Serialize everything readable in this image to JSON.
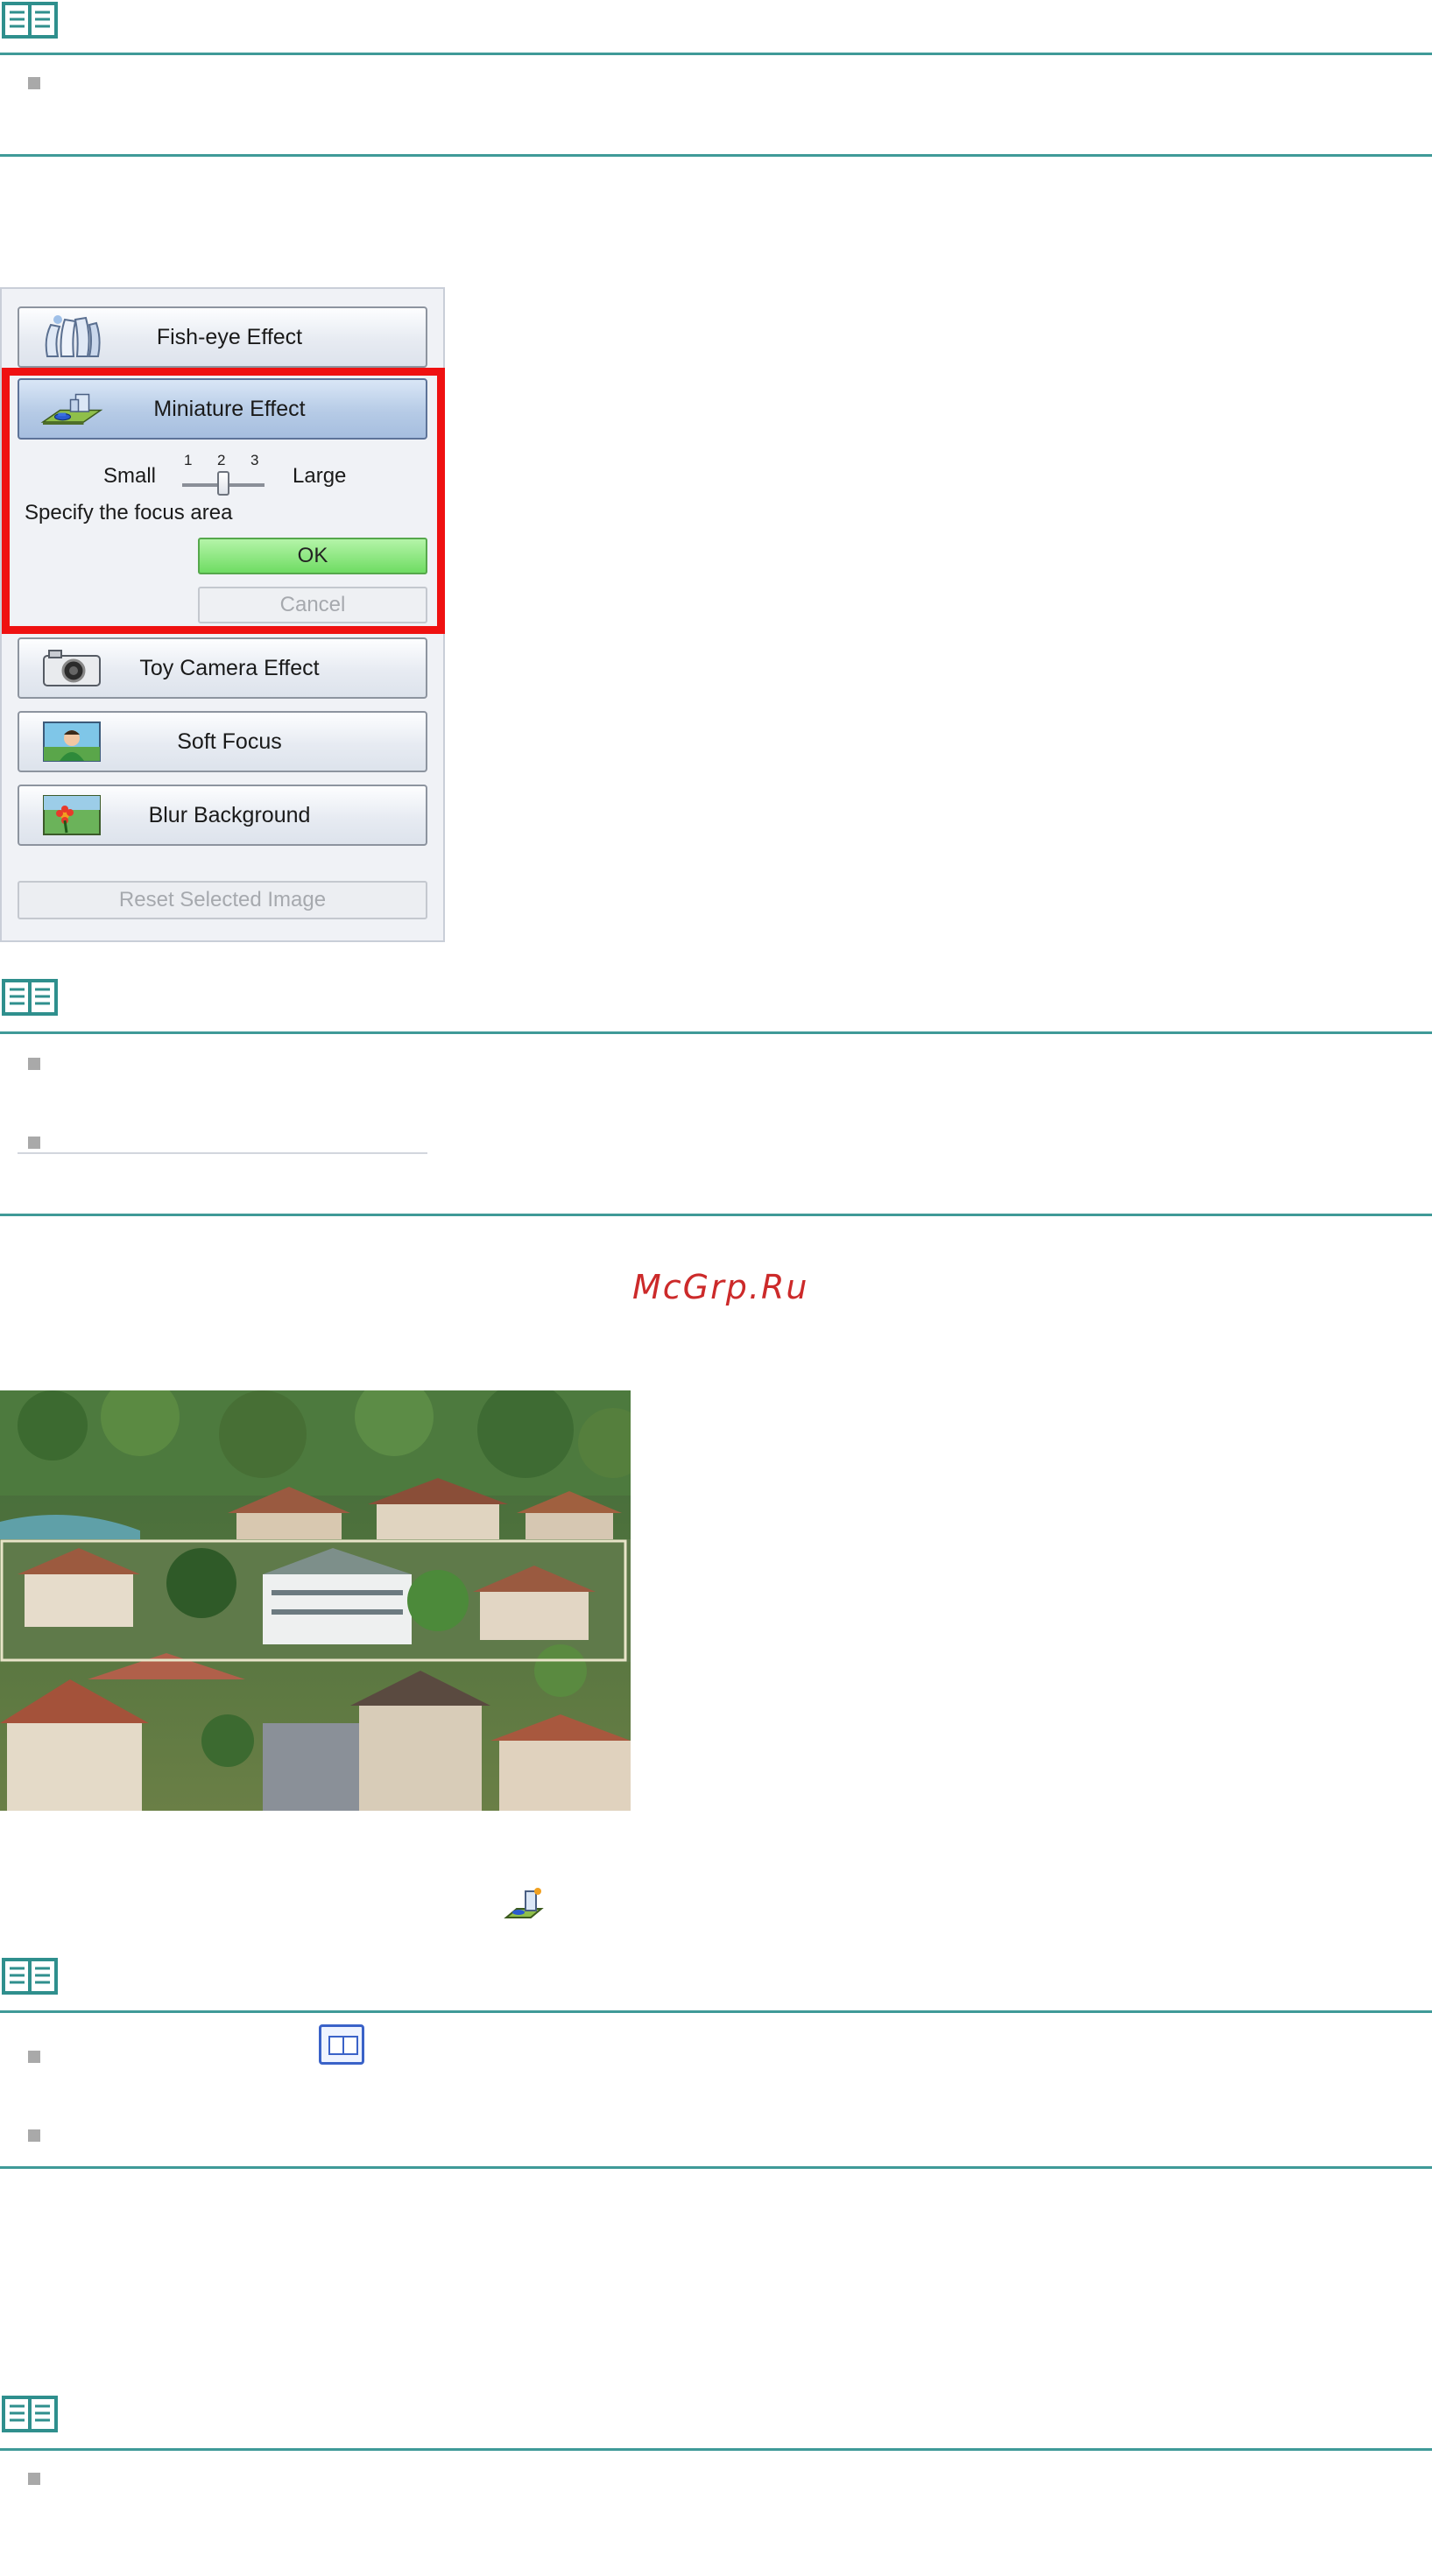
{
  "effects_panel": {
    "buttons": [
      {
        "label": "Fish-eye Effect",
        "icon": "fish-eye-icon"
      },
      {
        "label": "Miniature Effect",
        "icon": "miniature-icon"
      },
      {
        "label": "Toy Camera Effect",
        "icon": "camera-icon"
      },
      {
        "label": "Soft Focus",
        "icon": "portrait-icon"
      },
      {
        "label": "Blur Background",
        "icon": "flower-icon"
      }
    ],
    "miniature_options": {
      "small_label": "Small",
      "large_label": "Large",
      "ticks": [
        "1",
        "2",
        "3"
      ],
      "slider_value": 2,
      "focus_text": "Specify the focus area",
      "ok_label": "OK",
      "cancel_label": "Cancel"
    },
    "reset_label": "Reset Selected Image",
    "highlight_color": "#ef1111"
  },
  "watermark": "McGrp.Ru",
  "colors": {
    "rule": "#3f9a98",
    "note_icon": "#2f8f8d",
    "bullet": "#a9a9a9"
  }
}
